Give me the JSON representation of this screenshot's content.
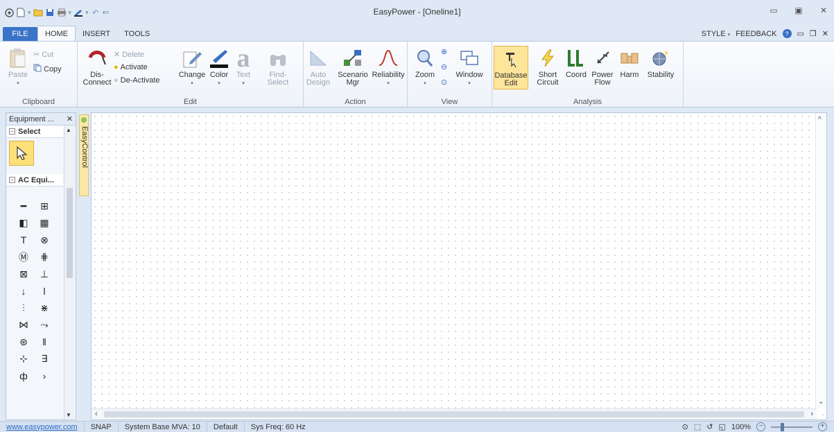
{
  "window": {
    "title": "EasyPower - [Oneline1]",
    "controls": {
      "minimize": "▭",
      "maximize": "▣",
      "close": "✕"
    }
  },
  "quick_access": {
    "icons": [
      "app-menu-icon",
      "new-doc-icon",
      "open-folder-icon",
      "save-icon",
      "print-icon",
      "color-brush-icon",
      "undo-icon",
      "customize-qat-icon"
    ]
  },
  "tabs": [
    {
      "label": "FILE"
    },
    {
      "label": "HOME"
    },
    {
      "label": "INSERT"
    },
    {
      "label": "TOOLS"
    }
  ],
  "tabs_right": {
    "style": "STYLE",
    "feedback": "FEEDBACK"
  },
  "ribbon": {
    "clipboard": {
      "label": "Clipboard",
      "paste": "Paste",
      "cut": "Cut",
      "copy": "Copy"
    },
    "edit": {
      "label": "Edit",
      "disconnect": "Dis-\nConnect",
      "delete": "Delete",
      "activate": "Activate",
      "deactivate": "De-Activate",
      "change": "Change",
      "color": "Color",
      "text": "Text",
      "find_select": "Find-\nSelect"
    },
    "action": {
      "label": "Action",
      "auto_design": "Auto\nDesign",
      "scenario_mgr": "Scenario\nMgr",
      "reliability": "Reliability"
    },
    "view": {
      "label": "View",
      "zoom": "Zoom",
      "window": "Window"
    },
    "analysis": {
      "label": "Analysis",
      "database_edit": "Database\nEdit",
      "short_circuit": "Short\nCircuit",
      "coord": "Coord",
      "power_flow": "Power\nFlow",
      "harm": "Harm",
      "stability": "Stability"
    }
  },
  "equipment_panel": {
    "title": "Equipment ...",
    "close": "✕",
    "select_section": "Select",
    "ac_section": "AC Equi..."
  },
  "easycontrol": {
    "label": "EasyControl"
  },
  "statusbar": {
    "website": "www.easypower.com",
    "snap": "SNAP",
    "system_base": "System Base MVA: 10",
    "default": "Default",
    "sys_freq": "Sys Freq: 60 Hz",
    "zoom": "100%"
  },
  "colors": {
    "file_tab": "#3a73c8",
    "highlight": "#fde59a",
    "chrome": "#dfe9f5"
  }
}
